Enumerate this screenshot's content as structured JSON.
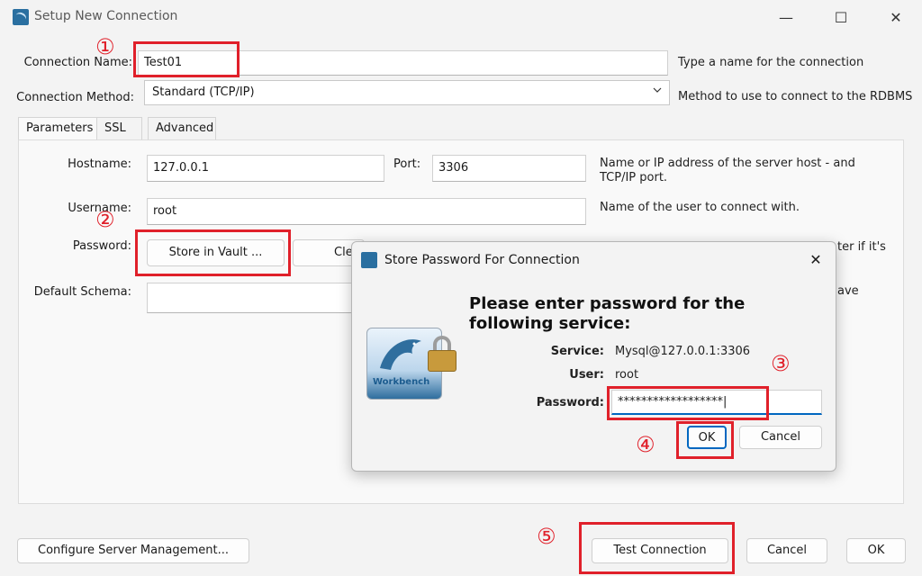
{
  "window": {
    "title": "Setup New Connection",
    "minimize_glyph": "—",
    "maximize_glyph": "☐",
    "close_glyph": "✕"
  },
  "connection_name": {
    "label": "Connection Name:",
    "value": "Test01",
    "hint": "Type a name for the connection"
  },
  "connection_method": {
    "label": "Connection Method:",
    "value": "Standard (TCP/IP)",
    "hint": "Method to use to connect to the RDBMS"
  },
  "tabs": [
    {
      "label": "Parameters"
    },
    {
      "label": "SSL"
    },
    {
      "label": "Advanced"
    }
  ],
  "parameters": {
    "hostname_label": "Hostname:",
    "hostname_value": "127.0.0.1",
    "port_label": "Port:",
    "port_value": "3306",
    "hostname_hint": "Name or IP address of the server host - and TCP/IP port.",
    "username_label": "Username:",
    "username_value": "root",
    "username_hint": "Name of the user to connect with.",
    "password_label": "Password:",
    "store_vault_label": "Store in Vault ...",
    "clear_label": "Cle",
    "password_hint_partial": "ter if it's",
    "default_schema_label": "Default Schema:",
    "default_schema_hint_partial": "ave"
  },
  "footer": {
    "configure_label": "Configure Server Management...",
    "test_label": "Test Connection",
    "cancel_label": "Cancel",
    "ok_label": "OK"
  },
  "dialog": {
    "title": "Store Password For Connection",
    "close_glyph": "✕",
    "prompt": "Please enter password for the following service:",
    "service_label": "Service:",
    "service_value": "Mysql@127.0.0.1:3306",
    "user_label": "User:",
    "user_value": "root",
    "password_label": "Password:",
    "password_value": "******************|",
    "ok_label": "OK",
    "cancel_label": "Cancel",
    "logo_text": "Workbench"
  },
  "annotations": {
    "step1": "①",
    "step2": "②",
    "step3": "③",
    "step4": "④",
    "step5": "⑤"
  },
  "colors": {
    "annotation_red": "#e0202a",
    "focus_blue": "#0067c0",
    "window_bg": "#f3f3f3"
  }
}
